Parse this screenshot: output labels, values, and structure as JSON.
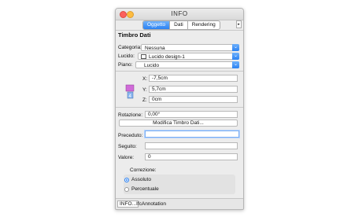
{
  "window": {
    "title": "INFO"
  },
  "tabs": [
    {
      "label": "Oggetto",
      "active": true
    },
    {
      "label": "Dati",
      "active": false
    },
    {
      "label": "Rendering",
      "active": false
    }
  ],
  "section_title": "Timbro Dati",
  "categoria": {
    "label": "Categoria:",
    "value": "Nessuna"
  },
  "lucidi": {
    "label": "Lucido:",
    "value": "Lucido design-1"
  },
  "piano": {
    "label": "Piano:",
    "value": "Lucido"
  },
  "coords": {
    "x": {
      "label": "X:",
      "value": "-7,5cm"
    },
    "y": {
      "label": "Y:",
      "value": "5,7cm"
    },
    "z": {
      "label": "Z:",
      "value": "0cm"
    }
  },
  "rotazione": {
    "label": "Rotazione:",
    "value": "0,00°"
  },
  "modifica_button": "Modifica Timbro Dati...",
  "preceduto": {
    "label": "Preceduto:",
    "value": ""
  },
  "seguito": {
    "label": "Seguito:",
    "value": ""
  },
  "valore": {
    "label": "Valore:",
    "value": "0"
  },
  "correzione": {
    "label": "Correzione:",
    "options": [
      {
        "label": "Assoluto",
        "selected": true
      },
      {
        "label": "Percentuale",
        "selected": false
      }
    ]
  },
  "bottom": {
    "info_button": "INFO...",
    "text": "IfcAnnotation"
  },
  "colors": {
    "accent": "#2b82f3",
    "close": "#fc605c",
    "minimize": "#fdbc40"
  }
}
